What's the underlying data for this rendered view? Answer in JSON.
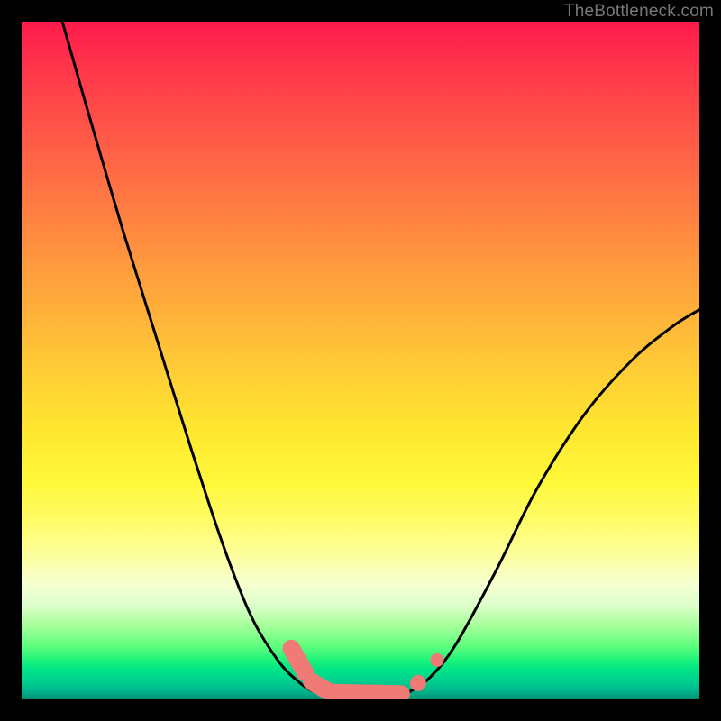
{
  "watermark": "TheBottleneck.com",
  "chart_data": {
    "type": "line",
    "title": "",
    "xlabel": "",
    "ylabel": "",
    "xlim": [
      0,
      1
    ],
    "ylim": [
      0,
      1
    ],
    "series": [
      {
        "name": "curve-left",
        "x": [
          0.06,
          0.1,
          0.15,
          0.2,
          0.25,
          0.3,
          0.34,
          0.38,
          0.41,
          0.43,
          0.45
        ],
        "y": [
          1.0,
          0.86,
          0.69,
          0.53,
          0.37,
          0.22,
          0.12,
          0.055,
          0.025,
          0.012,
          0.01
        ]
      },
      {
        "name": "curve-right",
        "x": [
          0.57,
          0.6,
          0.64,
          0.7,
          0.76,
          0.83,
          0.9,
          0.96,
          1.0
        ],
        "y": [
          0.01,
          0.03,
          0.08,
          0.19,
          0.31,
          0.42,
          0.5,
          0.55,
          0.575
        ]
      },
      {
        "name": "flat-bottom",
        "x": [
          0.45,
          0.48,
          0.51,
          0.54,
          0.57
        ],
        "y": [
          0.008,
          0.005,
          0.005,
          0.006,
          0.01
        ]
      }
    ],
    "markers": [
      {
        "kind": "capsule",
        "x0": 0.398,
        "y0": 0.075,
        "x1": 0.418,
        "y1": 0.04,
        "r": 0.013
      },
      {
        "kind": "capsule",
        "x0": 0.428,
        "y0": 0.026,
        "x1": 0.452,
        "y1": 0.012,
        "r": 0.013
      },
      {
        "kind": "capsule",
        "x0": 0.455,
        "y0": 0.01,
        "x1": 0.56,
        "y1": 0.008,
        "r": 0.013
      },
      {
        "kind": "dot",
        "cx": 0.585,
        "cy": 0.024,
        "r": 0.012
      },
      {
        "kind": "dot",
        "cx": 0.613,
        "cy": 0.058,
        "r": 0.01
      }
    ],
    "marker_color": "#ef7a76",
    "curve_color": "#000000",
    "curve_width": 3
  }
}
